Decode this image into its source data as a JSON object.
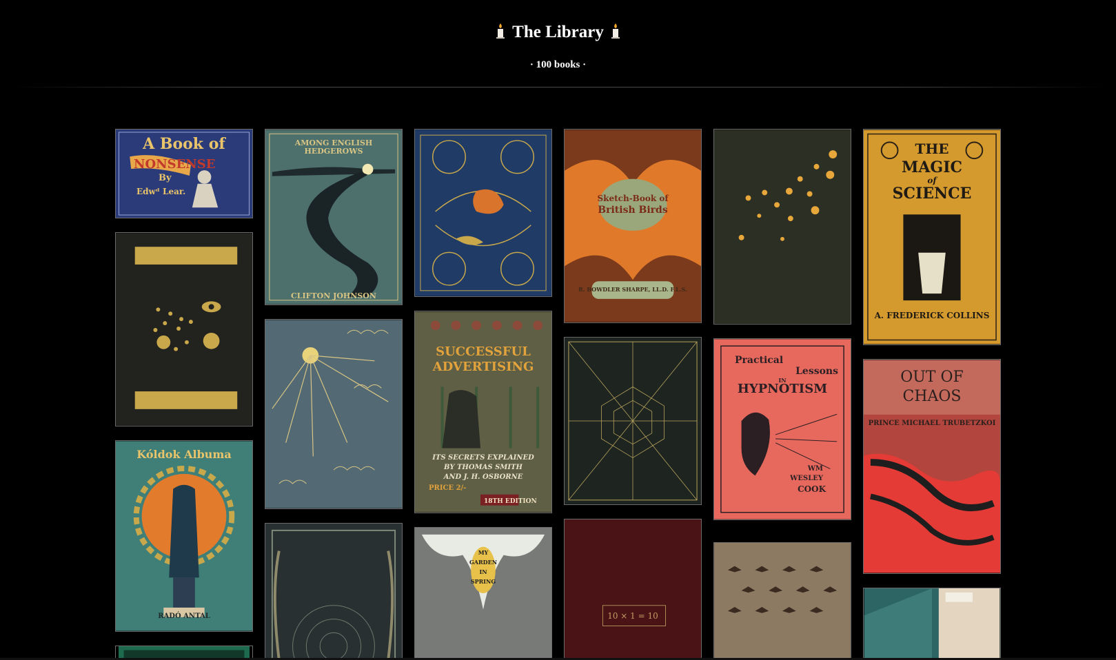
{
  "header": {
    "title": "The Library",
    "candle_icon": "candle-icon",
    "subtitle": "· 100 books ·"
  },
  "colors": {
    "background": "#000000",
    "text": "#ffffff",
    "rule": "#4a4a4a"
  },
  "books": {
    "a_book_of_nonsense": {
      "line1": "A Book of",
      "line2": "NONSENSE",
      "line3": "By",
      "line4": "Edwᵈ Lear."
    },
    "among_english_hedgerows": {
      "title": "AMONG ENGLISH HEDGEROWS",
      "author": "CLIFTON JOHNSON"
    },
    "sketch_book_british_birds": {
      "line1": "Sketch-Book of",
      "line2": "British Birds",
      "author": "R. BOWDLER SHARPE, LL.D. F.L.S."
    },
    "magic_of_science": {
      "line1": "THE",
      "line2": "MAGIC",
      "line3": "of",
      "line4": "SCIENCE",
      "author": "A. FREDERICK COLLINS"
    },
    "successful_advertising": {
      "line1": "SUCCESSFUL",
      "line2": "ADVERTISING",
      "line3": "ITS SECRETS EXPLAINED",
      "line4": "BY THOMAS SMITH",
      "line5": "AND J. H. OSBORNE",
      "price": "PRICE 2/-",
      "edition": "18TH EDITION"
    },
    "koldok_album": {
      "title": "Kóldok Albuma",
      "author": "RADÓ ANTAL"
    },
    "practical_lessons_hypnotism": {
      "line1": "Practical",
      "line2": "Lessons",
      "line3": "IN",
      "line4": "HYPNOTISM",
      "author1": "WM",
      "author2": "WESLEY",
      "author3": "COOK"
    },
    "out_of_chaos": {
      "line1": "OUT OF",
      "line2": "CHAOS",
      "author": "PRINCE MICHAEL TRUBETZKOI"
    },
    "my_garden_in_spring": {
      "line1": "MY",
      "line2": "GARDEN",
      "line3": "IN",
      "line4": "SPRING"
    },
    "ten_times_one": {
      "label": "10 × 1 = 10"
    }
  }
}
